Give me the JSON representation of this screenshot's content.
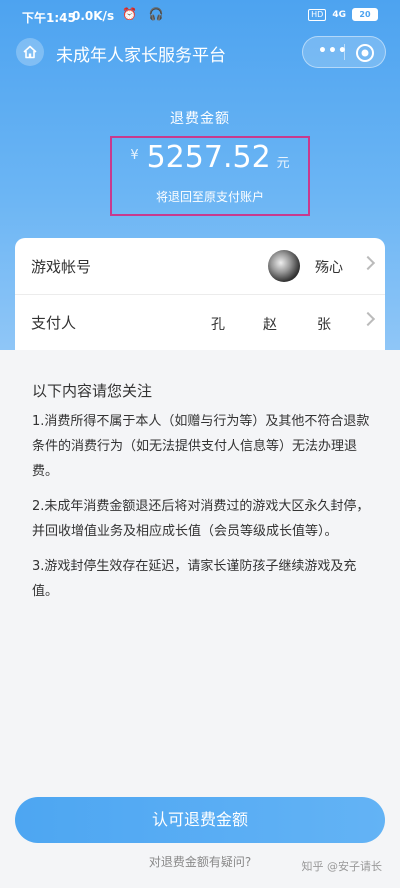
{
  "status_bar": {
    "time": "下午1:45",
    "network_speed": "0.0K/s",
    "icons": "⏰ 🎧",
    "hd": "HD",
    "signal": "4G",
    "battery": "20"
  },
  "navbar": {
    "title": "未成年人家长服务平台",
    "more_dots": "•••",
    "home_icon": "home-icon",
    "target_icon": "target-icon"
  },
  "refund": {
    "label": "退费金额",
    "currency": "¥",
    "amount": "5257.52",
    "unit": "元",
    "subtitle": "将退回至原支付账户"
  },
  "account": {
    "game_account_label": "游戏帐号",
    "game_account_name": "殇心",
    "payer_label": "支付人",
    "payer_names": [
      "孔",
      "赵",
      "张"
    ]
  },
  "notes": {
    "title": "以下内容请您关注",
    "items": [
      "1.消费所得不属于本人（如赠与行为等）及其他不符合退款条件的消费行为（如无法提供支付人信息等）无法办理退费。",
      "2.未成年消费金额退还后将对消费过的游戏大区永久封停，并回收增值业务及相应成长值（会员等级成长值等）。",
      "3.游戏封停生效存在延迟，请家长谨防孩子继续游戏及充值。"
    ]
  },
  "actions": {
    "confirm": "认可退费金额",
    "question": "对退费金额有疑问?"
  },
  "watermark": "知乎 @安子请长",
  "colors": {
    "primary": "#4da3f0",
    "highlight_border": "#c83a8e"
  }
}
